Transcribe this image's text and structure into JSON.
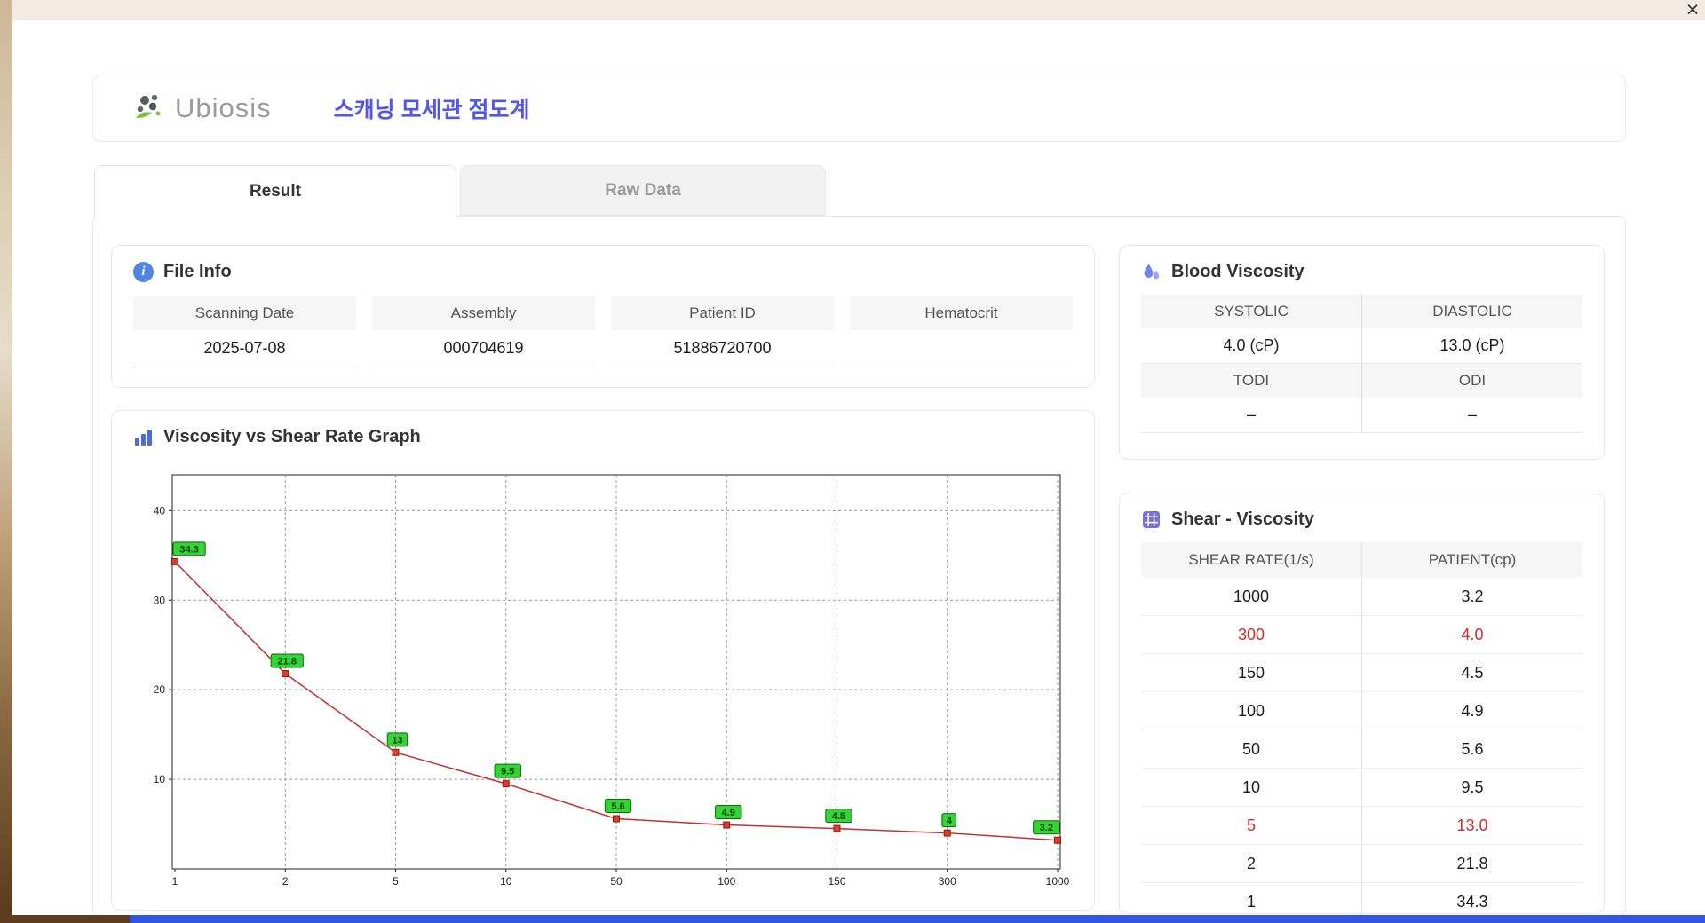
{
  "window": {
    "close_label": "×"
  },
  "header": {
    "logo_text": "Ubiosis",
    "title": "스캐닝 모세관 점도계"
  },
  "tabs": [
    {
      "label": "Result",
      "active": true
    },
    {
      "label": "Raw Data",
      "active": false
    }
  ],
  "file_info": {
    "title": "File Info",
    "fields": [
      {
        "label": "Scanning Date",
        "value": "2025-07-08"
      },
      {
        "label": "Assembly",
        "value": "000704619"
      },
      {
        "label": "Patient ID",
        "value": "51886720700"
      },
      {
        "label": "Hematocrit",
        "value": ""
      }
    ]
  },
  "blood_viscosity": {
    "title": "Blood Viscosity",
    "rows": [
      {
        "labels": [
          "SYSTOLIC",
          "DIASTOLIC"
        ],
        "values": [
          "4.0 (cP)",
          "13.0 (cP)"
        ]
      },
      {
        "labels": [
          "TODI",
          "ODI"
        ],
        "values": [
          "–",
          "–"
        ]
      }
    ]
  },
  "shear_viscosity": {
    "title": "Shear - Viscosity",
    "headers": [
      "SHEAR RATE(1/s)",
      "PATIENT(cp)"
    ],
    "rows": [
      {
        "shear": "1000",
        "patient": "3.2",
        "highlight": false
      },
      {
        "shear": "300",
        "patient": "4.0",
        "highlight": true
      },
      {
        "shear": "150",
        "patient": "4.5",
        "highlight": false
      },
      {
        "shear": "100",
        "patient": "4.9",
        "highlight": false
      },
      {
        "shear": "50",
        "patient": "5.6",
        "highlight": false
      },
      {
        "shear": "10",
        "patient": "9.5",
        "highlight": false
      },
      {
        "shear": "5",
        "patient": "13.0",
        "highlight": true
      },
      {
        "shear": "2",
        "patient": "21.8",
        "highlight": false
      },
      {
        "shear": "1",
        "patient": "34.3",
        "highlight": false
      }
    ]
  },
  "chart_data": {
    "type": "line",
    "title": "Viscosity vs Shear Rate Graph",
    "x_categories": [
      "1",
      "2",
      "5",
      "10",
      "50",
      "100",
      "150",
      "300",
      "1000"
    ],
    "values": [
      34.3,
      21.8,
      13,
      9.5,
      5.6,
      4.9,
      4.5,
      4,
      3.2
    ],
    "point_labels": [
      "34.3",
      "21.8",
      "13",
      "9.5",
      "5.6",
      "4.9",
      "4.5",
      "4",
      "3.2"
    ],
    "y_ticks": [
      10,
      20,
      30,
      40
    ],
    "ylim": [
      0,
      44
    ],
    "grid": "dashed",
    "legend": "none",
    "line_color": "#c43131",
    "marker_color": "#e03a2f",
    "marker_border": "#8d1a12",
    "label_bg": "#35d435",
    "label_border": "#156615"
  }
}
